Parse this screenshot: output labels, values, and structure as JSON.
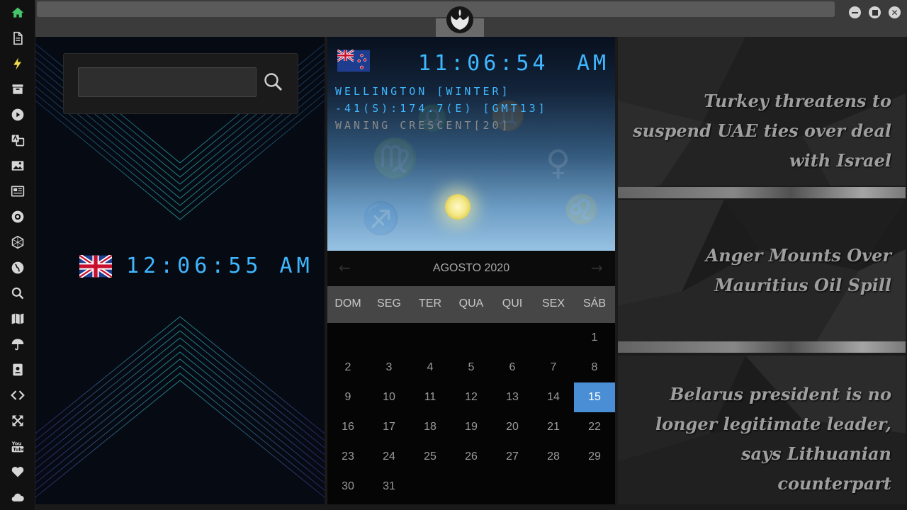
{
  "sidebar": {
    "items": [
      {
        "icon": "home-icon",
        "color": "#46c46a"
      },
      {
        "icon": "document-icon"
      },
      {
        "icon": "lightning-icon",
        "color": "#f2d84b"
      },
      {
        "icon": "archive-icon"
      },
      {
        "icon": "play-icon"
      },
      {
        "icon": "translate-icon"
      },
      {
        "icon": "image-icon"
      },
      {
        "icon": "newspaper-icon"
      },
      {
        "icon": "rebel-alliance-icon"
      },
      {
        "icon": "hexagon-icon"
      },
      {
        "icon": "globe-icon"
      },
      {
        "icon": "search-icon"
      },
      {
        "icon": "map-icon"
      },
      {
        "icon": "umbrella-icon"
      },
      {
        "icon": "contacts-icon"
      },
      {
        "icon": "code-icon"
      },
      {
        "icon": "expand-icon"
      },
      {
        "icon": "youtube-icon"
      },
      {
        "icon": "heart-icon"
      },
      {
        "icon": "cloud-icon"
      }
    ]
  },
  "window": {
    "logo": "rebel-alliance-logo",
    "controls": [
      "minimize-icon",
      "maximize-icon",
      "close-icon"
    ]
  },
  "search": {
    "value": "",
    "placeholder": "",
    "icon": "search-icon"
  },
  "uk_clock": {
    "flag": "united-kingdom-flag",
    "time": "12:06:55 AM",
    "color": "#3fb7ff"
  },
  "nz_clock": {
    "flag": "new-zealand-flag",
    "time": "11:06:54",
    "ampm": "AM",
    "location": "WELLINGTON [WINTER]",
    "coords": "-41(S):174.7(E) [GMT13]",
    "moon": "WANING CRESCENT[20]",
    "accent_color": "#3fb7ff"
  },
  "calendar": {
    "month_label": "AGOSTO 2020",
    "weekdays": [
      "DOM",
      "SEG",
      "TER",
      "QUA",
      "QUI",
      "SEX",
      "SÁB"
    ],
    "today": "15",
    "today_color": "#4a8fd6",
    "days": [
      "1",
      "2",
      "3",
      "4",
      "5",
      "6",
      "7",
      "8",
      "9",
      "10",
      "11",
      "12",
      "13",
      "14",
      "15",
      "16",
      "17",
      "18",
      "19",
      "20",
      "21",
      "22",
      "23",
      "24",
      "25",
      "26",
      "27",
      "28",
      "29",
      "30",
      "31"
    ]
  },
  "news": {
    "items": [
      "Turkey threatens to suspend UAE ties over deal with Israel",
      "Anger Mounts Over Mauritius Oil Spill",
      "Belarus president is no longer legitimate leader, says Lithuanian counterpart"
    ]
  }
}
